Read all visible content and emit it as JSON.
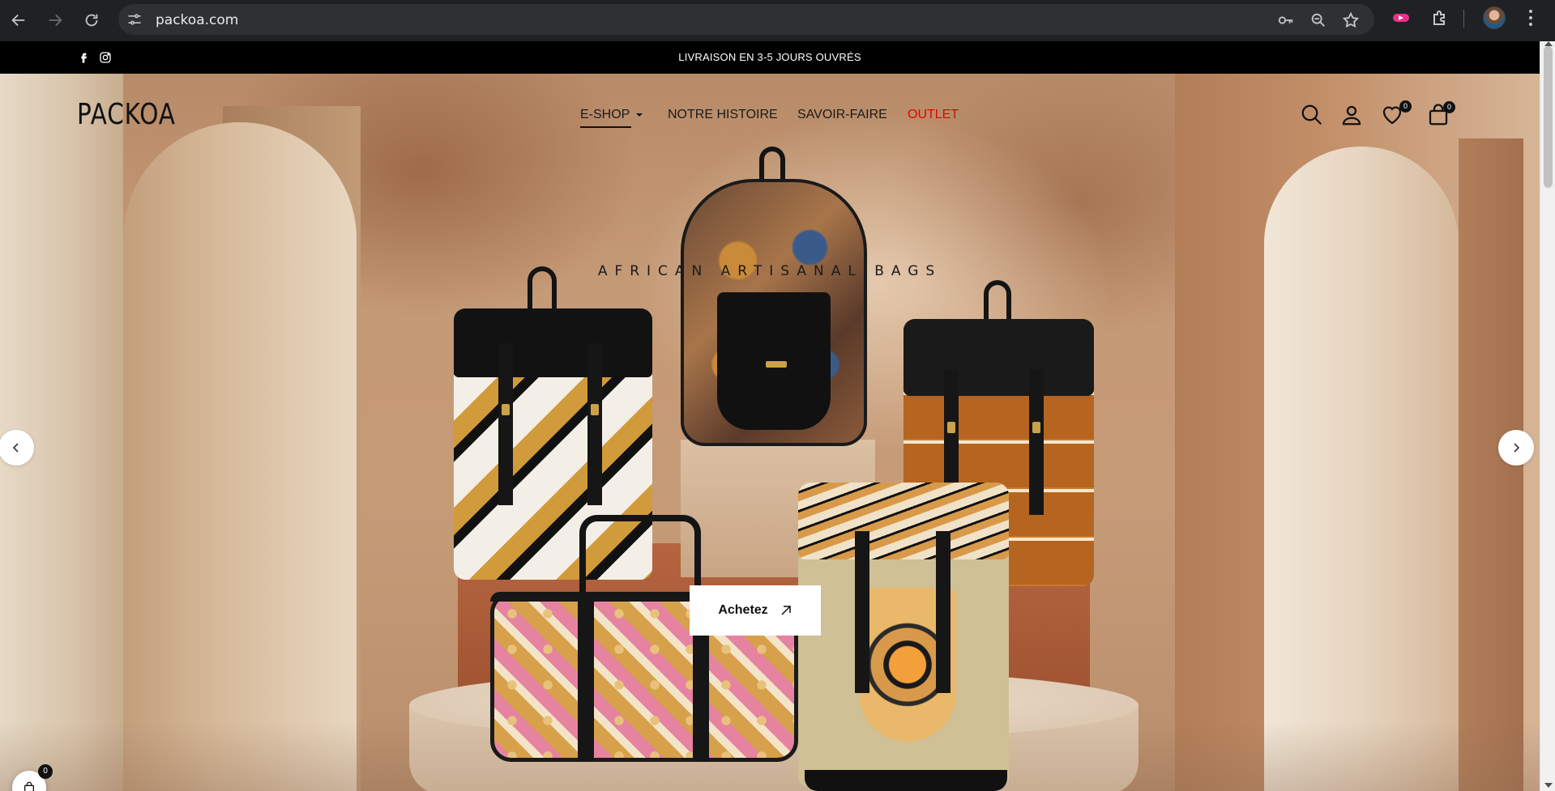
{
  "browser": {
    "url": "packoa.com",
    "icons": [
      "back-icon",
      "forward-icon",
      "reload-icon",
      "site-info-icon",
      "password-key-icon",
      "zoom-icon",
      "bookmark-star-icon",
      "extension-icon",
      "puzzle-icon",
      "profile-avatar",
      "menu-dots-icon"
    ]
  },
  "announcement": {
    "text": "LIVRAISON EN 3-5 JOURS OUVRÉS",
    "social": [
      "facebook-icon",
      "instagram-icon"
    ]
  },
  "header": {
    "logo": "PACKOA",
    "nav": [
      {
        "label": "E-SHOP",
        "active": true,
        "has_dropdown": true
      },
      {
        "label": "NOTRE HISTOIRE"
      },
      {
        "label": "SAVOIR-FAIRE"
      },
      {
        "label": "OUTLET",
        "color": "#e60000"
      }
    ],
    "wishlist_count": "0",
    "cart_count": "0"
  },
  "hero": {
    "tagline": "AFRICAN ARTISANAL BAGS",
    "cta_label": "Achetez"
  },
  "floating_cart": {
    "count": "0"
  },
  "colors": {
    "accent_outlet": "#e60000",
    "announcement_bg": "#000000",
    "text": "#111111"
  }
}
